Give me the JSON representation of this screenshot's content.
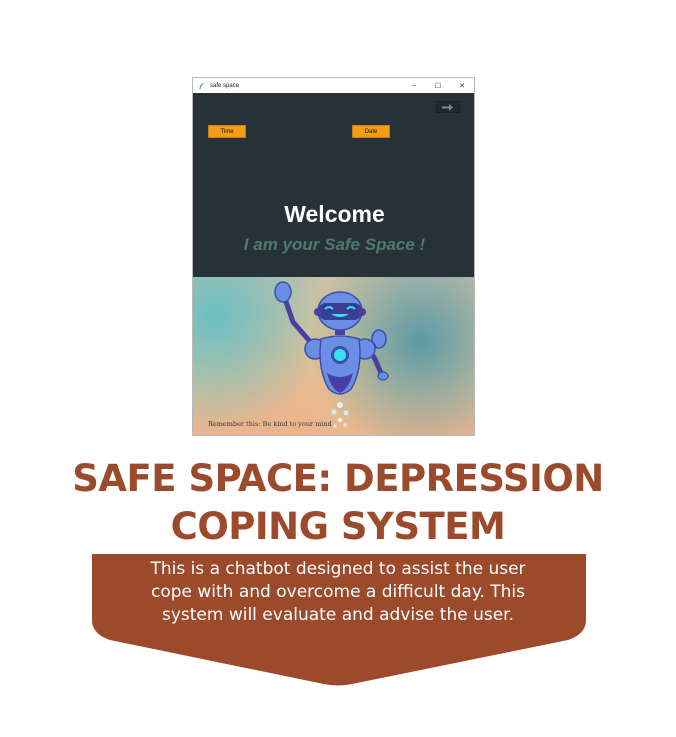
{
  "window": {
    "title": "safe space",
    "controls": {
      "minimize": "–",
      "maximize": "☐",
      "close": "✕"
    },
    "time_button": "Time",
    "date_button": "Date",
    "exit_icon": "exit-arrow-icon",
    "welcome": "Welcome",
    "tagline": "I am your Safe Space !",
    "footer_note": "Remember this: Be kind to your mind"
  },
  "poster": {
    "headline_line1": "SAFE SPACE: DEPRESSION",
    "headline_line2": "COPING SYSTEM",
    "description": "This is a chatbot designed to assist the user cope with and overcome a difficult day. This system will evaluate and advise the user."
  },
  "colors": {
    "dark_panel": "#263238",
    "button": "#f59d16",
    "tagline": "#4e7a6a",
    "headline": "#9c4a2c",
    "description_bg": "#9c4a2c"
  }
}
